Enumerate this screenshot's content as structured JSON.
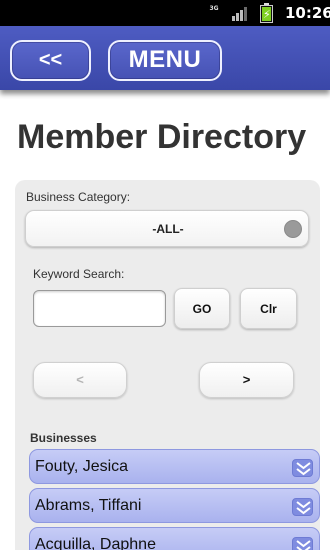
{
  "status_bar": {
    "network_label": "3G",
    "time": "10:26"
  },
  "header": {
    "back_label": "<<",
    "menu_label": "MENU"
  },
  "page": {
    "title": "Member Directory"
  },
  "filters": {
    "category_label": "Business Category:",
    "category_value": "-ALL-",
    "keyword_label": "Keyword Search:",
    "keyword_value": "",
    "go_label": "GO",
    "clear_label": "Clr",
    "prev_label": "<",
    "next_label": ">"
  },
  "businesses": {
    "heading": "Businesses",
    "items": [
      {
        "name": "Fouty, Jesica"
      },
      {
        "name": "Abrams, Tiffani"
      },
      {
        "name": "Acquilla, Daphne"
      }
    ]
  },
  "colors": {
    "header_blue": "#4552b6",
    "list_item_blue": "#b4bcf1"
  }
}
